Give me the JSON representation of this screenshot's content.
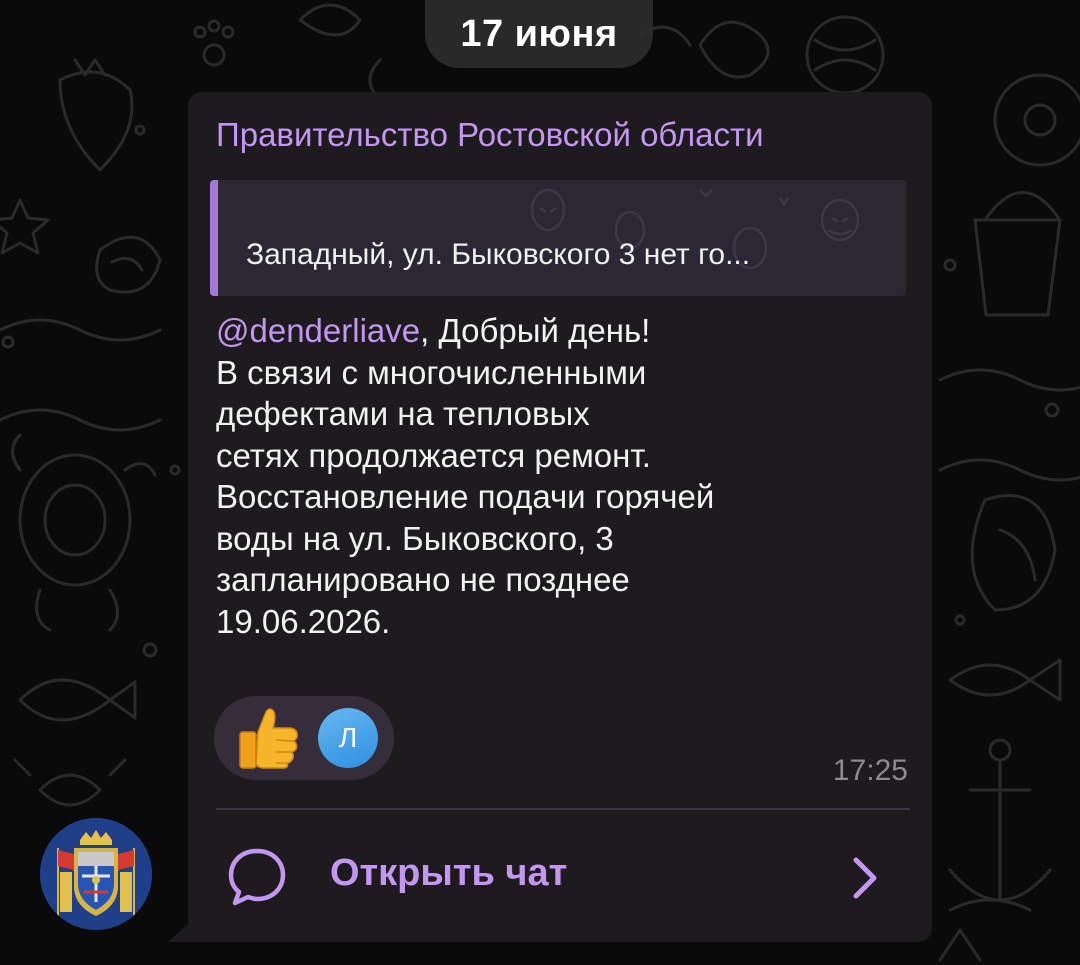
{
  "date_separator": "17 июня",
  "message": {
    "sender": "Правительство Ростовской области",
    "reply_preview": "Западный, ул. Быковского 3 нет го...",
    "mention": "@denderliave",
    "greeting": ", Добрый день!",
    "lines": [
      "В связи с многочисленными",
      "дефектами на тепловых",
      "сетях продолжается ремонт.",
      "Восстановление подачи горячей",
      "воды на ул. Быковского, 3",
      "запланировано не позднее",
      "19.06.2026."
    ],
    "reaction": {
      "emoji": "thumbs-up",
      "reactor_initial": "Л"
    },
    "time": "17:25",
    "open_chat_label": "Открыть чат"
  },
  "colors": {
    "accent": "#c496f1",
    "bubble": "#1d1b1e",
    "reaction_avatar": "#3c98e6"
  },
  "icons": {
    "open_chat": "chat-bubble-icon",
    "arrow": "chevron-right-icon",
    "avatar": "rostov-coat-of-arms"
  }
}
